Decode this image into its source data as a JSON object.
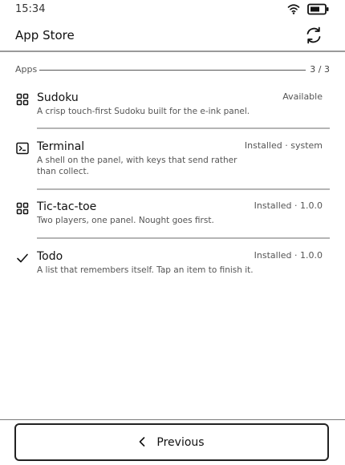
{
  "status_bar": {
    "time": "15:34",
    "wifi_icon": "wifi-icon",
    "battery_icon": "battery-icon"
  },
  "header": {
    "title": "App Store",
    "refresh_icon": "refresh-icon"
  },
  "section": {
    "label": "Apps",
    "count": "3 / 3"
  },
  "apps": [
    {
      "name": "Sudoku",
      "status": "Available",
      "description": "A crisp touch-first Sudoku built for the e-ink panel.",
      "icon": "grid-icon"
    },
    {
      "name": "Terminal",
      "status": "Installed · system",
      "description": "A shell on the panel, with keys that send rather than collect.",
      "icon": "terminal-icon"
    },
    {
      "name": "Tic-tac-toe",
      "status": "Installed · 1.0.0",
      "description": "Two players, one panel. Nought goes first.",
      "icon": "grid-icon"
    },
    {
      "name": "Todo",
      "status": "Installed · 1.0.0",
      "description": "A list that remembers itself. Tap an item to finish it.",
      "icon": "check-icon"
    }
  ],
  "footer": {
    "previous_label": "Previous",
    "chevron_icon": "chevron-left-icon"
  }
}
